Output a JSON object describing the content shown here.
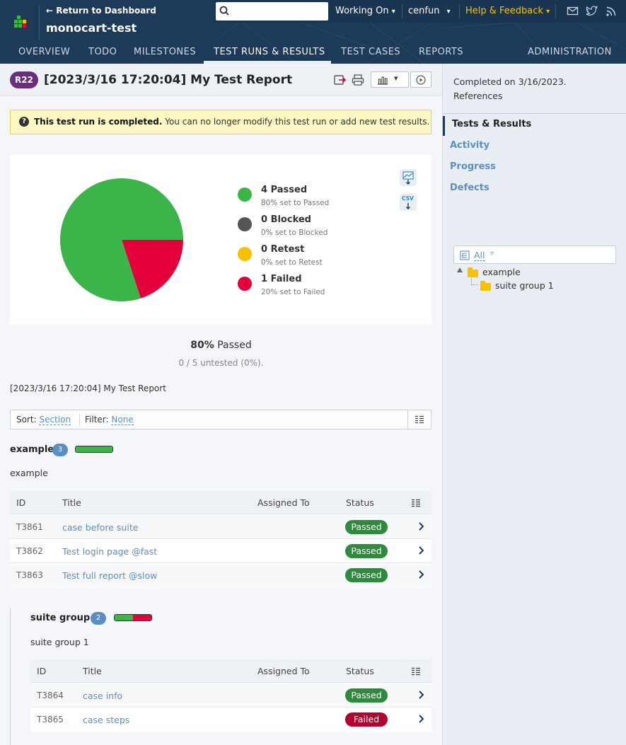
{
  "header": {
    "return_link": "Return to Dashboard",
    "project": "monocart-test",
    "search": {
      "placeholder": "",
      "value": ""
    },
    "working_on": "Working On",
    "user": "cenfun",
    "help": "Help & Feedback"
  },
  "nav": {
    "tabs": [
      {
        "label": "OVERVIEW"
      },
      {
        "label": "TODO"
      },
      {
        "label": "MILESTONES"
      },
      {
        "label": "TEST RUNS & RESULTS"
      },
      {
        "label": "TEST CASES"
      },
      {
        "label": "REPORTS"
      }
    ],
    "admin": "ADMINISTRATION",
    "active_tab": "TEST RUNS & RESULTS"
  },
  "run": {
    "badge": "R22",
    "title": "[2023/3/16 17:20:04] My Test Report"
  },
  "notice": {
    "bold": "This test run is completed.",
    "text": "You can no longer modify this test run or add new test results."
  },
  "summary": {
    "legend": [
      {
        "main": "4 Passed",
        "sub": "80% set to Passed",
        "color": "#3bb54a"
      },
      {
        "main": "0 Blocked",
        "sub": "0% set to Blocked",
        "color": "#555555"
      },
      {
        "main": "0 Retest",
        "sub": "0% set to Retest",
        "color": "#f6c100"
      },
      {
        "main": "1 Failed",
        "sub": "20% set to Failed",
        "color": "#e4003a"
      }
    ],
    "percent": "80%",
    "percent_label": "Passed",
    "untested": "0 / 5 untested (0%).",
    "csv_label": "CSV"
  },
  "chart_data": {
    "type": "pie",
    "categories": [
      "Passed",
      "Blocked",
      "Retest",
      "Failed"
    ],
    "values": [
      4,
      0,
      0,
      1
    ],
    "colors": [
      "#3bb54a",
      "#555555",
      "#f6c100",
      "#e4003a"
    ]
  },
  "report_name": "[2023/3/16 17:20:04] My Test Report",
  "sortbar": {
    "sort_label": "Sort:",
    "sort_value": "Section",
    "filter_label": "Filter:",
    "filter_value": "None"
  },
  "table_headers": {
    "id": "ID",
    "title": "Title",
    "assigned": "Assigned To",
    "status": "Status"
  },
  "sections": [
    {
      "name": "example",
      "count": "3",
      "description": "example",
      "passed_fraction": 1.0,
      "failed_fraction": 0.0,
      "rows": [
        {
          "id": "T3861",
          "title": "case before suite",
          "status": "Passed"
        },
        {
          "id": "T3862",
          "title": "Test login page @fast",
          "status": "Passed"
        },
        {
          "id": "T3863",
          "title": "Test full report @slow",
          "status": "Passed"
        }
      ]
    },
    {
      "name": "suite group 1",
      "count": "2",
      "description": "suite group 1",
      "passed_fraction": 0.5,
      "failed_fraction": 0.5,
      "rows": [
        {
          "id": "T3864",
          "title": "case info",
          "status": "Passed"
        },
        {
          "id": "T3865",
          "title": "case steps",
          "status": "Failed"
        }
      ]
    }
  ],
  "status_colors": {
    "Passed": "#2e8b3d",
    "Failed": "#b3002d"
  },
  "sidebar": {
    "completed": "Completed on 3/16/2023.",
    "references": "References",
    "nav": [
      {
        "label": "Tests & Results"
      },
      {
        "label": "Activity"
      },
      {
        "label": "Progress"
      },
      {
        "label": "Defects"
      }
    ],
    "filter": "All",
    "tree": [
      {
        "label": "example"
      },
      {
        "label": "suite group 1"
      }
    ]
  }
}
